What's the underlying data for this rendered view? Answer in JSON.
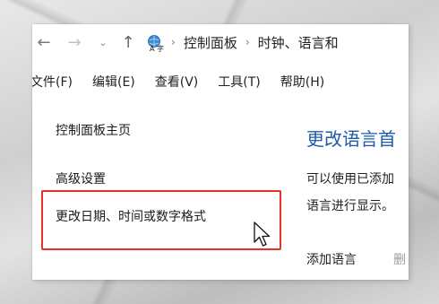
{
  "address_bar": {
    "back_icon": "arrow-left-icon",
    "forward_icon": "arrow-right-icon",
    "recent_icon": "chevron-down-icon",
    "up_icon": "arrow-up-icon",
    "location_icon": "control-panel-region-icon",
    "crumbs": [
      "控制面板",
      "时钟、语言和"
    ]
  },
  "menu": {
    "items": [
      "文件(F)",
      "编辑(E)",
      "查看(V)",
      "工具(T)",
      "帮助(H)"
    ]
  },
  "left_pane": {
    "items": [
      "控制面板主页",
      "高级设置",
      "更改日期、时间或数字格式"
    ]
  },
  "right_pane": {
    "title": "更改语言首",
    "description_line1": "可以使用已添加",
    "description_line2": "语言进行显示。",
    "add_language": "添加语言",
    "remove": "删"
  },
  "colors": {
    "highlight_border": "#e2342b",
    "title_blue": "#1e5aa8"
  }
}
